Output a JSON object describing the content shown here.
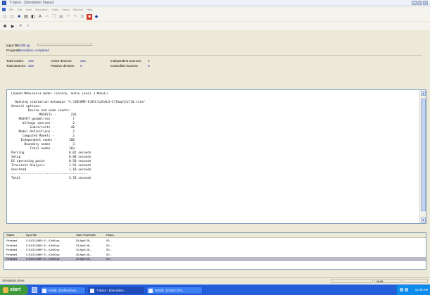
{
  "window": {
    "title": "T-Spice - [Simulation Status]"
  },
  "menu": [
    "File",
    "Edit",
    "View",
    "Simulation",
    "Table",
    "Setup",
    "Window",
    "Help"
  ],
  "run_info": {
    "input_file_label": "Input file:",
    "input_file_value": "Cell0.sp",
    "progress_label": "Progress:",
    "progress_value": "Simulation completed",
    "progress_fraction": 1.0
  },
  "stats": {
    "total_nodes_label": "Total nodes:",
    "total_nodes": "103",
    "active_devices_label": "Active devices:",
    "active_devices": "226",
    "independent_sources_label": "Independent sources:",
    "independent_sources": "2",
    "total_devices_label": "Total devices:",
    "total_devices": "228",
    "passive_devices_label": "Passive devices:",
    "passive_devices": "0",
    "controlled_sources_label": "Controlled sources:",
    "controlled_sources": "0"
  },
  "console_text": "Loaded MOSLevel3 model library, SPICE Level 3 MOSFET\n\n  Opening simulation database \"C:\\DOCUME~1\\HCL\\LOCALS~1\\Temp\\Cell0.tsim\"\nGeneral options:\n         Device and node counts:\n               MOSFETs -        226\n    MOSFET geometries -          7\n      Voltage sources -          2\n          Subcircuits -         48\n    Model Definitions -          2\n      Computed Models -          2\n     Independent nodes -       100\n       Boundary nodes -          3\n          Total nodes -        103\nParsing                        0.02 seconds\nSetup                          0.08 seconds\nDC operating point             0.50 seconds\nTransient Analysis             1.91 seconds\nOverhead                       1.10 seconds\n-----------------------------------------\nTotal                          3.70 seconds\n",
  "history": {
    "columns": [
      "Status",
      "Input file",
      "Start Time/Date",
      "Elaps..."
    ],
    "rows": [
      [
        "Finished",
        "C:\\DOCUME~1\\...\\Cell0.sp",
        "53 April 28,...",
        "00..."
      ],
      [
        "Finished",
        "C:\\DOCUME~1\\...\\Cell0.sp",
        "33 April 28,...",
        "00..."
      ],
      [
        "Finished",
        "C:\\DOCUME~1\\...\\Cell0.sp",
        "20 April 28,...",
        "00..."
      ],
      [
        "Finished",
        "C:\\DOCUME~1\\...\\Cell0.sp",
        "26 April 28,...",
        "00..."
      ],
      [
        "Finished",
        "C:\\DOCUME~1\\...\\Cell0.sp",
        "22 April 28,...",
        "00..."
      ]
    ],
    "selected_row": 4
  },
  "statusbar": {
    "message": "Simulation done.",
    "num": "NUM"
  },
  "taskbar": {
    "start": "start",
    "tasks": [
      "S-Edit - [Cell0.schem...",
      "T-Spice - [Simulation ...",
      "W-Edit - [Chart1 (Tra..."
    ],
    "clock": "11:38 AM"
  },
  "colors": {
    "taskbar": "#245edb",
    "start": "#3c9a3c",
    "selected_row": "#b9b9c8",
    "value_text": "#2a2a9a"
  }
}
